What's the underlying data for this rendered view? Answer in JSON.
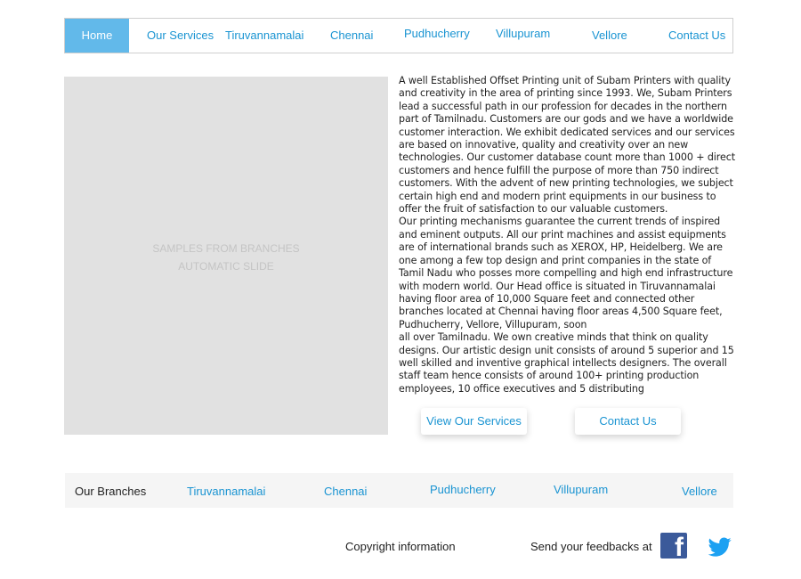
{
  "nav": {
    "home": "Home",
    "items": [
      "Our Services",
      "Tiruvannamalai",
      "Chennai",
      "Pudhucherry",
      "Villupuram",
      "Vellore",
      "Contact Us"
    ]
  },
  "slideshow": {
    "line1": "SAMPLES FROM BRANCHES",
    "line2": "AUTOMATIC SLIDE"
  },
  "about": {
    "lines": [
      "A well Established Offset Printing unit of Subam Printers with quality",
      "and creativity in the area of printing since 1993. We, Subam Printers",
      "lead a successful path in our profession for decades in the northern",
      "part of Tamilnadu. Customers are our gods and we have a worldwide",
      "customer interaction. We exhibit dedicated services and our services",
      "are based on innovative, quality and creativity over an new",
      "technologies. Our customer database count more than 1000 + direct",
      "customers and hence fulfill the purpose of more than 750 indirect",
      "customers. With the advent of new printing technologies, we subject",
      "certain high end and modern print equipments in our business to",
      "offer the fruit of satisfaction to our valuable customers.",
      "Our printing mechanisms guarantee the current trends of inspired",
      "and eminent outputs. All our print machines and assist equipments",
      "are of international brands such as XEROX, HP, Heidelberg. We are",
      "one among a few top design and print companies in the state of",
      "Tamil Nadu who posses more compelling and high end infrastructure",
      "with modern world. Our Head office is situated in Tiruvannamalai",
      "having floor area of 10,000 Square feet and connected other",
      "branches located at Chennai having floor areas 4,500 Square feet,",
      "Pudhucherry, Vellore, Villupuram, soon",
      "all over Tamilnadu. We own creative minds that think on quality",
      "designs. Our artistic design unit consists of around 5 superior and 15",
      "well skilled and inventive graphical intellects designers. The overall",
      "staff team hence consists of around 100+ printing production",
      "employees, 10 office executives and 5 distributing"
    ]
  },
  "buttons": {
    "view_services": "View Our Services",
    "contact_us": "Contact Us"
  },
  "branches": {
    "label": "Our Branches",
    "items": [
      "Tiruvannamalai",
      "Chennai",
      "Pudhucherry",
      "Villupuram",
      "Vellore"
    ]
  },
  "footer": {
    "copyright": "Copyright information",
    "feedback": "Send your feedbacks at",
    "facebook_icon": "facebook-icon",
    "twitter_icon": "twitter-icon"
  },
  "colors": {
    "accent": "#1a94d2",
    "home_active": "#62b9ea",
    "facebook": "#3b5a9a",
    "twitter": "#1da1f2"
  }
}
